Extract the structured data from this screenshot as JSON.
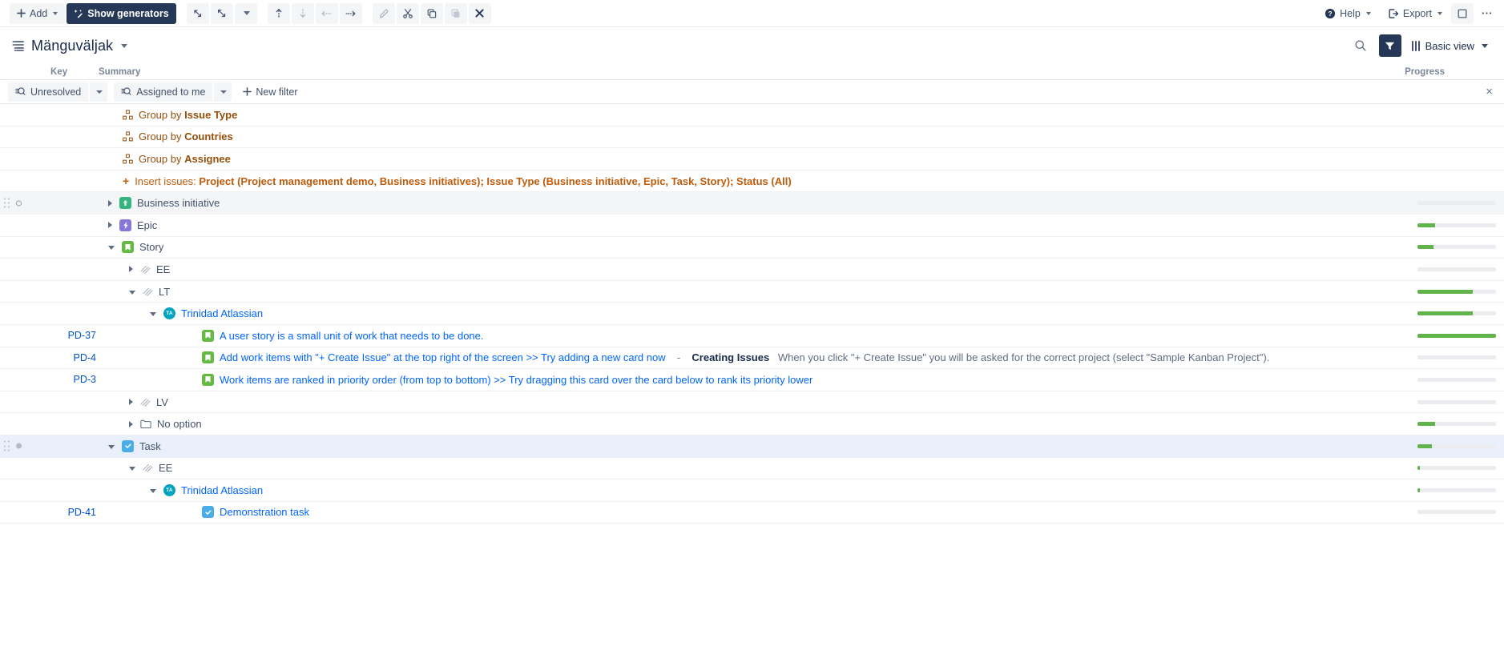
{
  "toolbar": {
    "add_label": "Add",
    "show_generators_label": "Show generators",
    "icons": [
      {
        "name": "expand-diagonal-icon",
        "enabled": true
      },
      {
        "name": "collapse-diagonal-icon",
        "enabled": true
      },
      {
        "name": "chevron-down-icon",
        "enabled": true
      },
      {
        "name": "move-up-icon",
        "enabled": true
      },
      {
        "name": "move-down-icon",
        "enabled": false
      },
      {
        "name": "outdent-icon",
        "enabled": false
      },
      {
        "name": "indent-icon",
        "enabled": true
      },
      {
        "name": "edit-pencil-icon",
        "enabled": false
      },
      {
        "name": "cut-scissors-icon",
        "enabled": true
      },
      {
        "name": "copy-icon",
        "enabled": true
      },
      {
        "name": "paste-icon",
        "enabled": false
      },
      {
        "name": "delete-x-icon",
        "enabled": true
      }
    ],
    "help_label": "Help",
    "export_label": "Export",
    "panel_toggle_name": "side-panel-toggle",
    "more_label": "•••"
  },
  "header": {
    "title": "Mänguväljak",
    "search_icon": "search-icon",
    "filter_icon": "filter-funnel-icon",
    "view_label": "Basic view"
  },
  "columns": {
    "key": "Key",
    "summary": "Summary",
    "progress": "Progress"
  },
  "filters": {
    "chips": [
      {
        "label": "Unresolved",
        "icon": "saved-filter-icon"
      },
      {
        "label": "Assigned to me",
        "icon": "saved-filter-icon"
      }
    ],
    "new_filter_label": "New filter",
    "close_label": "×"
  },
  "accent_colors": {
    "primary_button": "#253858",
    "link": "#0065ff",
    "key_link": "#0052cc",
    "generator_text": "#974f0c",
    "insert_text": "#bf5b0b",
    "progress_fill": "#61b34c",
    "progress_track": "#ebecf0",
    "selected_row": "#e9f0fb",
    "avatar": "#00a3bf"
  },
  "rows": [
    {
      "type": "generator",
      "name": "group-by-row",
      "prefix": "Group by ",
      "value": "Issue Type",
      "indent": 153,
      "icon": "group-by-icon",
      "progress": null
    },
    {
      "type": "generator",
      "name": "group-by-row",
      "prefix": "Group by ",
      "value": "Countries",
      "indent": 153,
      "icon": "group-by-icon",
      "progress": null
    },
    {
      "type": "generator",
      "name": "group-by-row",
      "prefix": "Group by ",
      "value": "Assignee",
      "indent": 153,
      "icon": "group-by-icon",
      "progress": null
    },
    {
      "type": "insert",
      "name": "insert-issues-row",
      "prefix": "Insert issues: ",
      "value": "Project (Project management demo, Business initiatives); Issue Type (Business initiative, Epic, Task, Story); Status (All)",
      "indent": 153,
      "icon": "plus-icon",
      "progress": null
    },
    {
      "type": "item",
      "name": "tree-row-business-initiative",
      "label": "Business initiative",
      "key": "",
      "indent": 135,
      "twisty": "closed",
      "icon": "initiative-icon",
      "icon_class": "ic-green",
      "icon_glyph": "↑",
      "highlight": "hl",
      "handle": true,
      "marker": "open",
      "progress": 0
    },
    {
      "type": "item",
      "name": "tree-row-epic",
      "label": "Epic",
      "key": "",
      "indent": 135,
      "twisty": "closed",
      "icon": "epic-icon",
      "icon_class": "ic-purple",
      "icon_glyph": "⚡",
      "progress": 22
    },
    {
      "type": "item",
      "name": "tree-row-story",
      "label": "Story",
      "key": "",
      "indent": 135,
      "twisty": "open",
      "icon": "story-icon",
      "icon_class": "ic-story",
      "icon_glyph": "▮",
      "progress": 20
    },
    {
      "type": "item",
      "name": "tree-row-ee",
      "label": "EE",
      "key": "",
      "indent": 161,
      "twisty": "closed",
      "icon": "no-value-hatch-icon",
      "progress": 0
    },
    {
      "type": "item",
      "name": "tree-row-lt",
      "label": "LT",
      "key": "",
      "indent": 161,
      "twisty": "open",
      "icon": "no-value-hatch-icon",
      "progress": 70
    },
    {
      "type": "item",
      "name": "tree-row-trinidad-atlassian",
      "label": "Trinidad Atlassian",
      "key": "",
      "indent": 187,
      "twisty": "open",
      "icon": "avatar-icon",
      "avatar_initials": "TA",
      "link": true,
      "progress": 70
    },
    {
      "type": "issue",
      "name": "tree-row-issue",
      "key": "PD-37",
      "label": "A user story is a small unit of work that needs to be done.",
      "indent": 232,
      "icon": "story-icon",
      "icon_class": "ic-story",
      "icon_glyph": "▮",
      "progress": 100
    },
    {
      "type": "issue",
      "name": "tree-row-issue",
      "key": "PD-4",
      "label": "Add work items with \"+ Create Issue\" at the top right of the screen >> Try adding a new card now",
      "desc_sep": "-",
      "desc_strong": "Creating Issues",
      "desc": "When you click \"+ Create Issue\" you will be asked for the correct project (select \"Sample Kanban Project\").",
      "indent": 232,
      "icon": "story-icon",
      "icon_class": "ic-story",
      "icon_glyph": "▮",
      "progress": 0
    },
    {
      "type": "issue",
      "name": "tree-row-issue",
      "key": "PD-3",
      "label": "Work items are ranked in priority order (from top to bottom) >> Try dragging this card over the card below to rank its priority lower",
      "indent": 232,
      "icon": "story-icon",
      "icon_class": "ic-story",
      "icon_glyph": "▮",
      "progress": 0
    },
    {
      "type": "item",
      "name": "tree-row-lv",
      "label": "LV",
      "key": "",
      "indent": 161,
      "twisty": "closed",
      "icon": "no-value-hatch-icon",
      "progress": 0
    },
    {
      "type": "item",
      "name": "tree-row-no-option",
      "label": "No option",
      "key": "",
      "indent": 161,
      "twisty": "closed",
      "icon": "folder-icon",
      "progress": 22
    },
    {
      "type": "item",
      "name": "tree-row-task",
      "label": "Task",
      "key": "",
      "indent": 135,
      "twisty": "open",
      "icon": "task-icon",
      "icon_class": "ic-blue",
      "icon_glyph": "✓",
      "highlight": "sel",
      "handle": true,
      "marker": "filled",
      "progress": 18
    },
    {
      "type": "item",
      "name": "tree-row-ee-2",
      "label": "EE",
      "key": "",
      "indent": 161,
      "twisty": "open",
      "icon": "no-value-hatch-icon",
      "progress": 3
    },
    {
      "type": "item",
      "name": "tree-row-trinidad-atlassian-2",
      "label": "Trinidad Atlassian",
      "key": "",
      "indent": 187,
      "twisty": "open",
      "icon": "avatar-icon",
      "avatar_initials": "TA",
      "link": true,
      "progress": 3
    },
    {
      "type": "issue",
      "name": "tree-row-issue",
      "key": "PD-41",
      "label": "Demonstration task",
      "indent": 232,
      "icon": "task-icon",
      "icon_class": "ic-blue",
      "icon_glyph": "✓",
      "progress": 0
    }
  ]
}
